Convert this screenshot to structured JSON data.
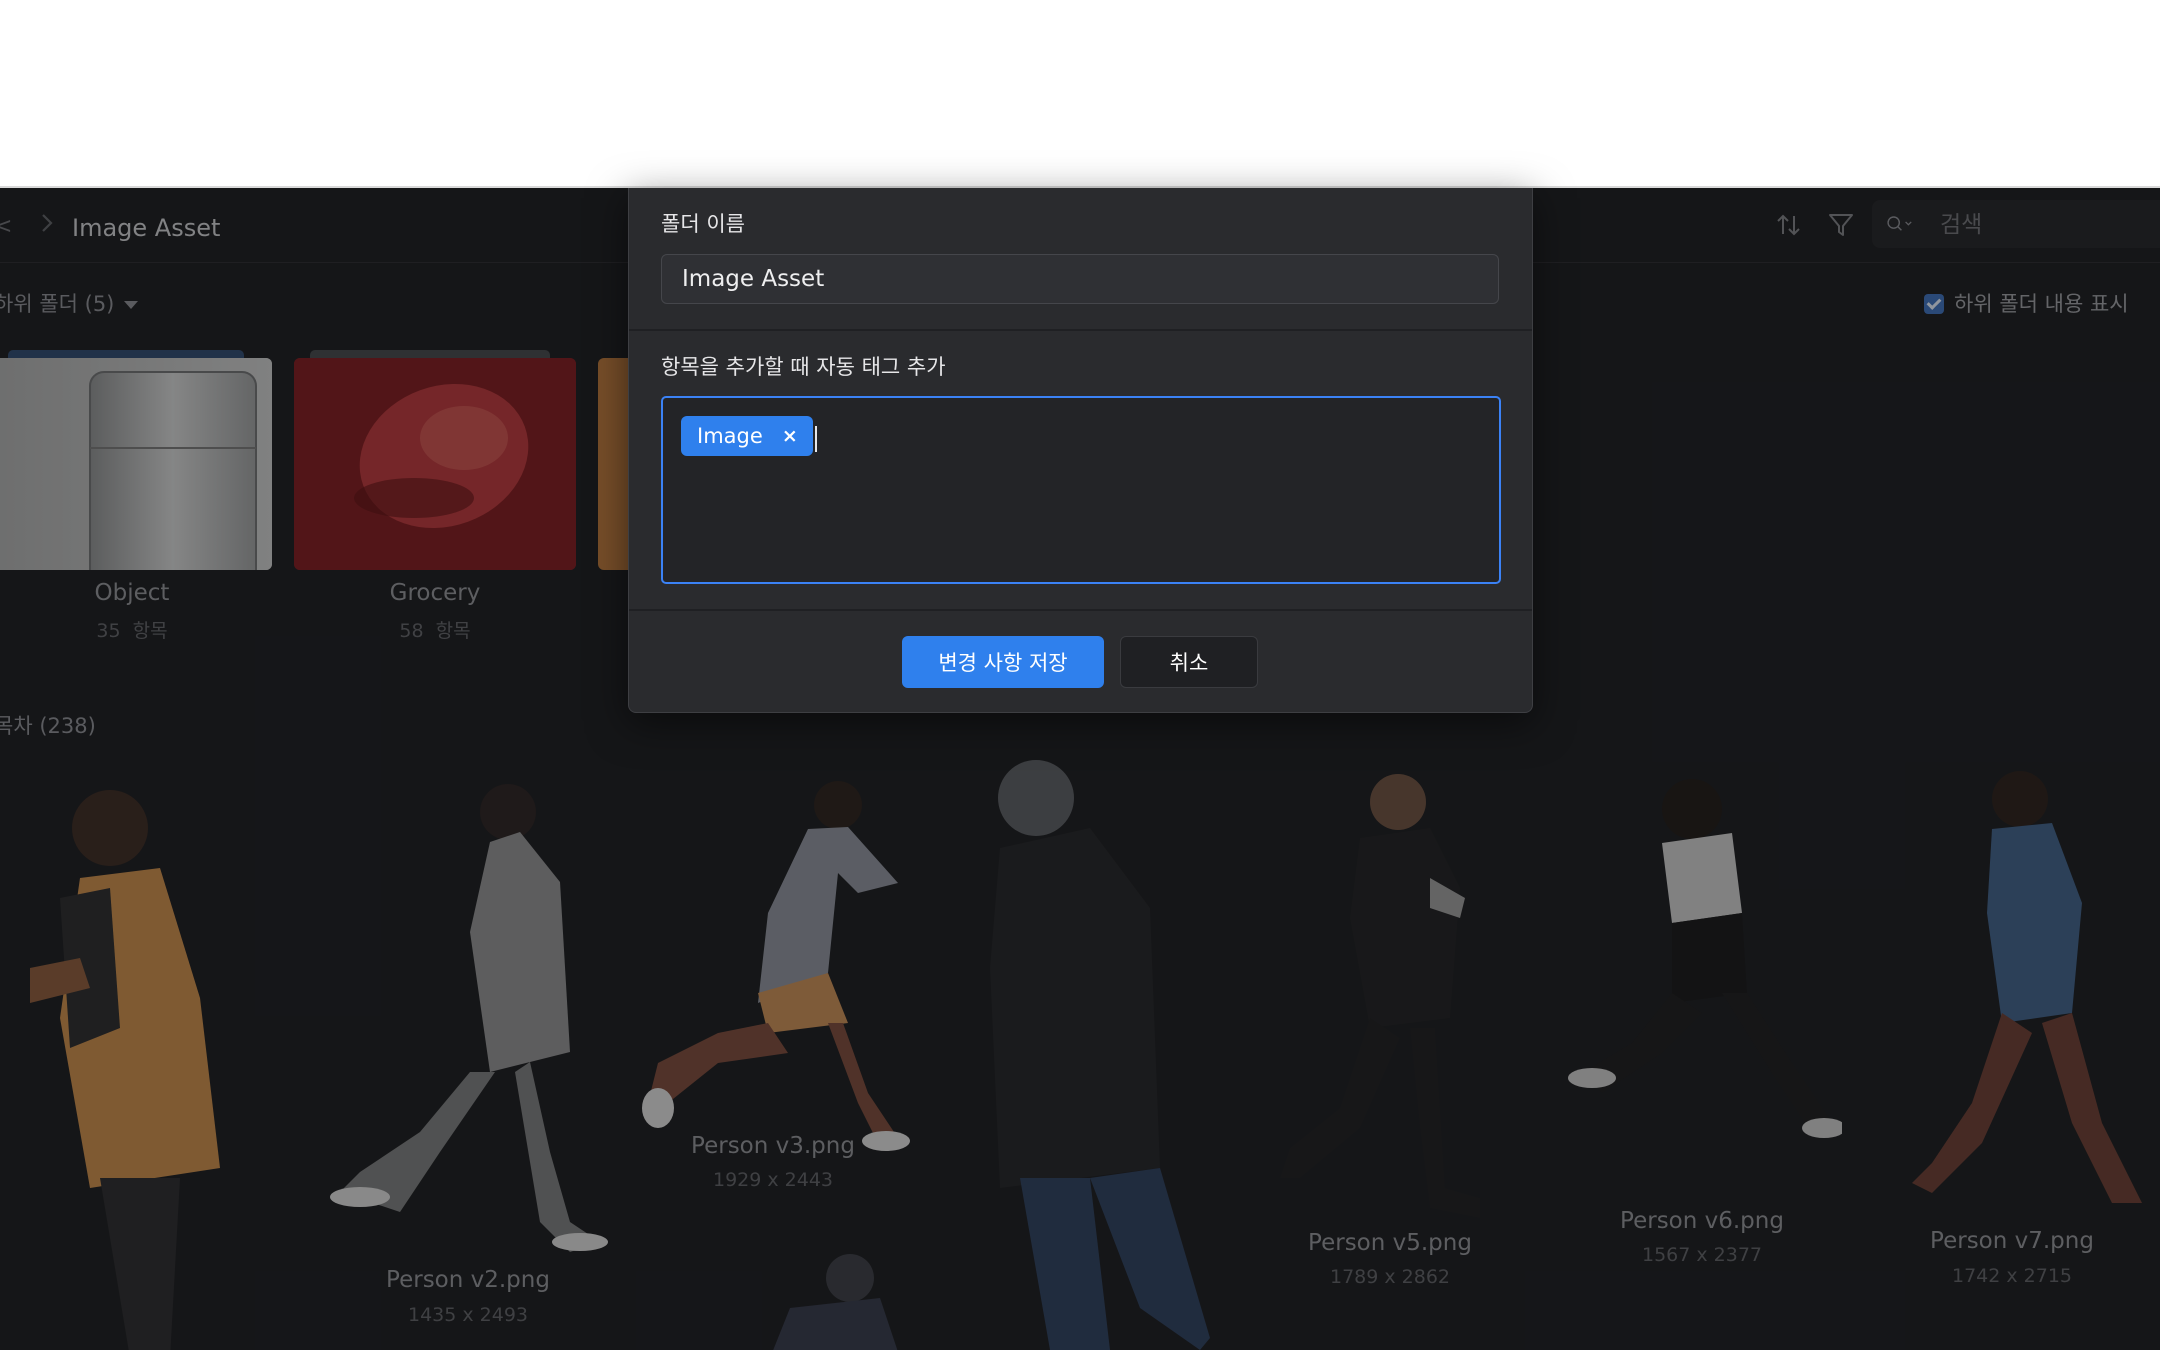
{
  "toolbar": {
    "back_glyph": "<",
    "breadcrumb_separator_icon": "chevron-right-icon",
    "title": "Image Asset",
    "sort_icon": "sort-icon",
    "filter_icon": "filter-icon",
    "search_icon": "search-icon",
    "search_placeholder": "검색"
  },
  "subfolders": {
    "header": "하위 폴더 (5)",
    "show_contents_label": "하위 폴더 내용 표시",
    "show_contents_checked": true,
    "items": [
      {
        "name": "Object",
        "count": "35",
        "unit": "항목"
      },
      {
        "name": "Grocery",
        "count": "58",
        "unit": "항목"
      }
    ]
  },
  "items": {
    "header": "목차 (238)",
    "list": [
      {
        "name": "",
        "dims": ""
      },
      {
        "name": "Person v2.png",
        "dims": "1435 x 2493"
      },
      {
        "name": "Person v3.png",
        "dims": "1929 x 2443"
      },
      {
        "name": "",
        "dims": ""
      },
      {
        "name": "Person v5.png",
        "dims": "1789 x 2862"
      },
      {
        "name": "Person v6.png",
        "dims": "1567 x 2377"
      },
      {
        "name": "Person v7.png",
        "dims": "1742 x 2715"
      }
    ]
  },
  "dialog": {
    "folder_name_label": "폴더 이름",
    "folder_name_value": "Image Asset",
    "auto_tag_label": "항목을 추가할 때 자동 태그 추가",
    "tags": [
      {
        "label": "Image"
      }
    ],
    "tag_remove_glyph": "×",
    "save_label": "변경 사항 저장",
    "cancel_label": "취소"
  },
  "colors": {
    "accent": "#2f80ed",
    "background": "#1b1c1f",
    "dialog": "#2a2b2e"
  }
}
